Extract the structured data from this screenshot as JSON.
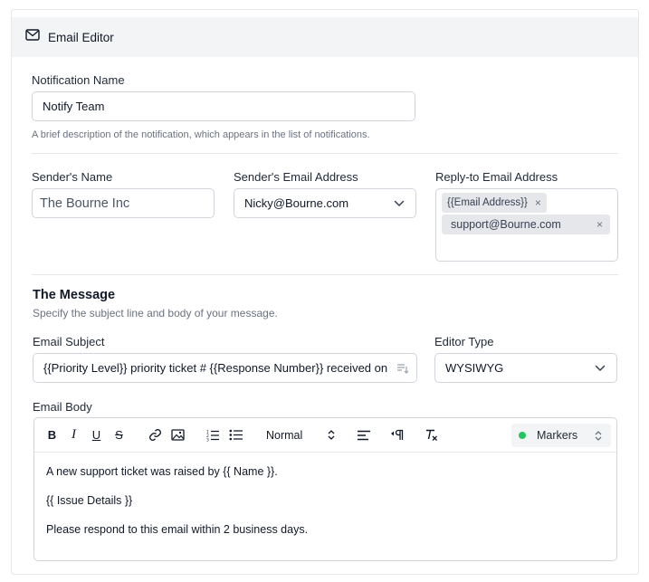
{
  "header": {
    "title": "Email Editor",
    "icon": "mail-icon"
  },
  "notification": {
    "label": "Notification Name",
    "value": "Notify Team",
    "help": "A brief description of the notification, which appears in the list of notifications."
  },
  "sender": {
    "name_label": "Sender's Name",
    "name_placeholder": "The Bourne Inc",
    "email_label": "Sender's Email Address",
    "email_value": "Nicky@Bourne.com",
    "reply_label": "Reply-to Email Address",
    "reply_tags": [
      {
        "label": "{{Email Address}}"
      },
      {
        "label": "support@Bourne.com"
      }
    ]
  },
  "message": {
    "title": "The Message",
    "subtitle": "Specify the subject line and body of your message.",
    "subject_label": "Email Subject",
    "subject_value": "{{Priority Level}} priority ticket # {{Response Number}} received on",
    "editor_type_label": "Editor Type",
    "editor_type_value": "WYSIWYG",
    "body_label": "Email Body"
  },
  "toolbar": {
    "bold": "B",
    "italic": "I",
    "underline": "U",
    "strike": "S",
    "format_value": "Normal",
    "markers_label": "Markers"
  },
  "body": {
    "lines": [
      "A new support ticket was raised by {{ Name }}.",
      "{{ Issue Details }}",
      "Please respond to this email within 2 business days."
    ]
  },
  "colors": {
    "accent_green": "#22c55e",
    "header_bg": "#f3f4f6",
    "border": "#d1d5db"
  }
}
